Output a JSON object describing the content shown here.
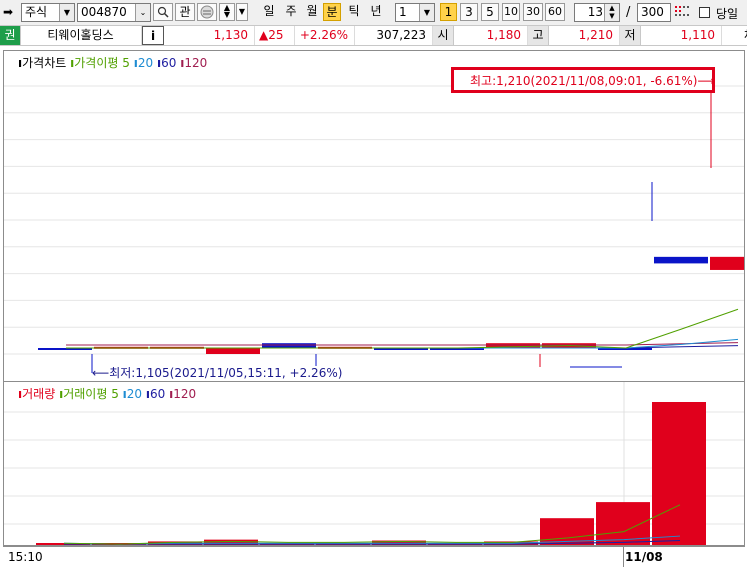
{
  "toolbar": {
    "market": "주식",
    "code": "004870",
    "search_icon": "magnifier-icon",
    "gwan_label": "관",
    "periods": [
      "일",
      "주",
      "월",
      "분",
      "틱",
      "년"
    ],
    "active_period": "분",
    "interval_value": "1",
    "interval_options": [
      "3",
      "5",
      "10",
      "30",
      "60"
    ],
    "count_value": "13",
    "separator": "/",
    "total_value": "300",
    "same_day_label": "당일"
  },
  "infobar": {
    "badge": "권",
    "name": "티웨이홀딩스",
    "info_label": "i",
    "price": "1,130",
    "change": "▲25",
    "change_rate": "+2.26%",
    "volume": "307,223",
    "open_label": "시",
    "open": "1,180",
    "high_label": "고",
    "high": "1,210",
    "low_label": "저",
    "low": "1,110",
    "trade_label": "체결강"
  },
  "price_panel": {
    "title": "가격차트",
    "ma_label": "가격이평",
    "ma_periods": [
      "5",
      "20",
      "60",
      "120"
    ],
    "high_annotation": "최고:1,210(2021/11/08,09:01, -6.61%)⟶",
    "low_annotation": "⟵최저:1,105(2021/11/05,15:11, +2.26%)"
  },
  "volume_panel": {
    "title": "거래량",
    "ma_label": "거래이평",
    "ma_periods": [
      "5",
      "20",
      "60",
      "120"
    ]
  },
  "axis": {
    "start_time": "15:10",
    "date_label": "11/08"
  },
  "colors": {
    "up": "#e0001c",
    "down": "#0a14c8",
    "ma5": "#50a000",
    "ma20": "#1e8cd2",
    "ma60": "#1e1ea0",
    "ma120": "#a01e50"
  },
  "chart_data": {
    "type": "candlestick",
    "price": {
      "min": 1105,
      "max": 1210,
      "candles": [
        {
          "dir": "down",
          "open": 1110,
          "close": 1109
        },
        {
          "dir": "up",
          "open": 1110,
          "close": 1111
        },
        {
          "dir": "up",
          "open": 1110,
          "close": 1111
        },
        {
          "dir": "up",
          "open": 1110,
          "close": 1105
        },
        {
          "dir": "down",
          "open": 1114,
          "close": 1110
        },
        {
          "dir": "up",
          "open": 1111,
          "close": 1110
        },
        {
          "dir": "down",
          "open": 1110,
          "close": 1109
        },
        {
          "dir": "down",
          "open": 1110,
          "close": 1109
        },
        {
          "dir": "up",
          "open": 1114,
          "close": 1110
        },
        {
          "dir": "up",
          "open": 1114,
          "close": 1110
        },
        {
          "dir": "down",
          "open": 1110,
          "close": 1109
        },
        {
          "dir": "down",
          "open": 1180,
          "close": 1175
        },
        {
          "dir": "up",
          "open": 1180,
          "close": 1170
        }
      ],
      "ma5": [
        1110,
        1110,
        1110,
        1110,
        1110,
        1110,
        1110,
        1110,
        1111,
        1112,
        1110,
        1125,
        1140
      ],
      "ma20": [
        1110,
        1110,
        1110,
        1110,
        1110,
        1110,
        1110,
        1110,
        1110,
        1110,
        1110,
        1113,
        1117
      ],
      "ma60": [
        1110,
        1110,
        1110,
        1110,
        1110,
        1110,
        1110,
        1110,
        1110,
        1110,
        1110,
        1111,
        1112
      ]
    },
    "volume": {
      "values": [
        2,
        1,
        4,
        6,
        2,
        2,
        5,
        2,
        4,
        30,
        48,
        160
      ],
      "ma5": [
        2,
        1,
        3,
        4,
        3,
        3,
        4,
        3,
        3,
        8,
        15,
        45
      ],
      "ma20": [
        2,
        1,
        2,
        2,
        2,
        2,
        2,
        2,
        2,
        4,
        6,
        10
      ],
      "ma60": [
        1,
        1,
        1,
        1,
        1,
        1,
        1,
        1,
        1,
        2,
        3,
        5
      ]
    }
  }
}
